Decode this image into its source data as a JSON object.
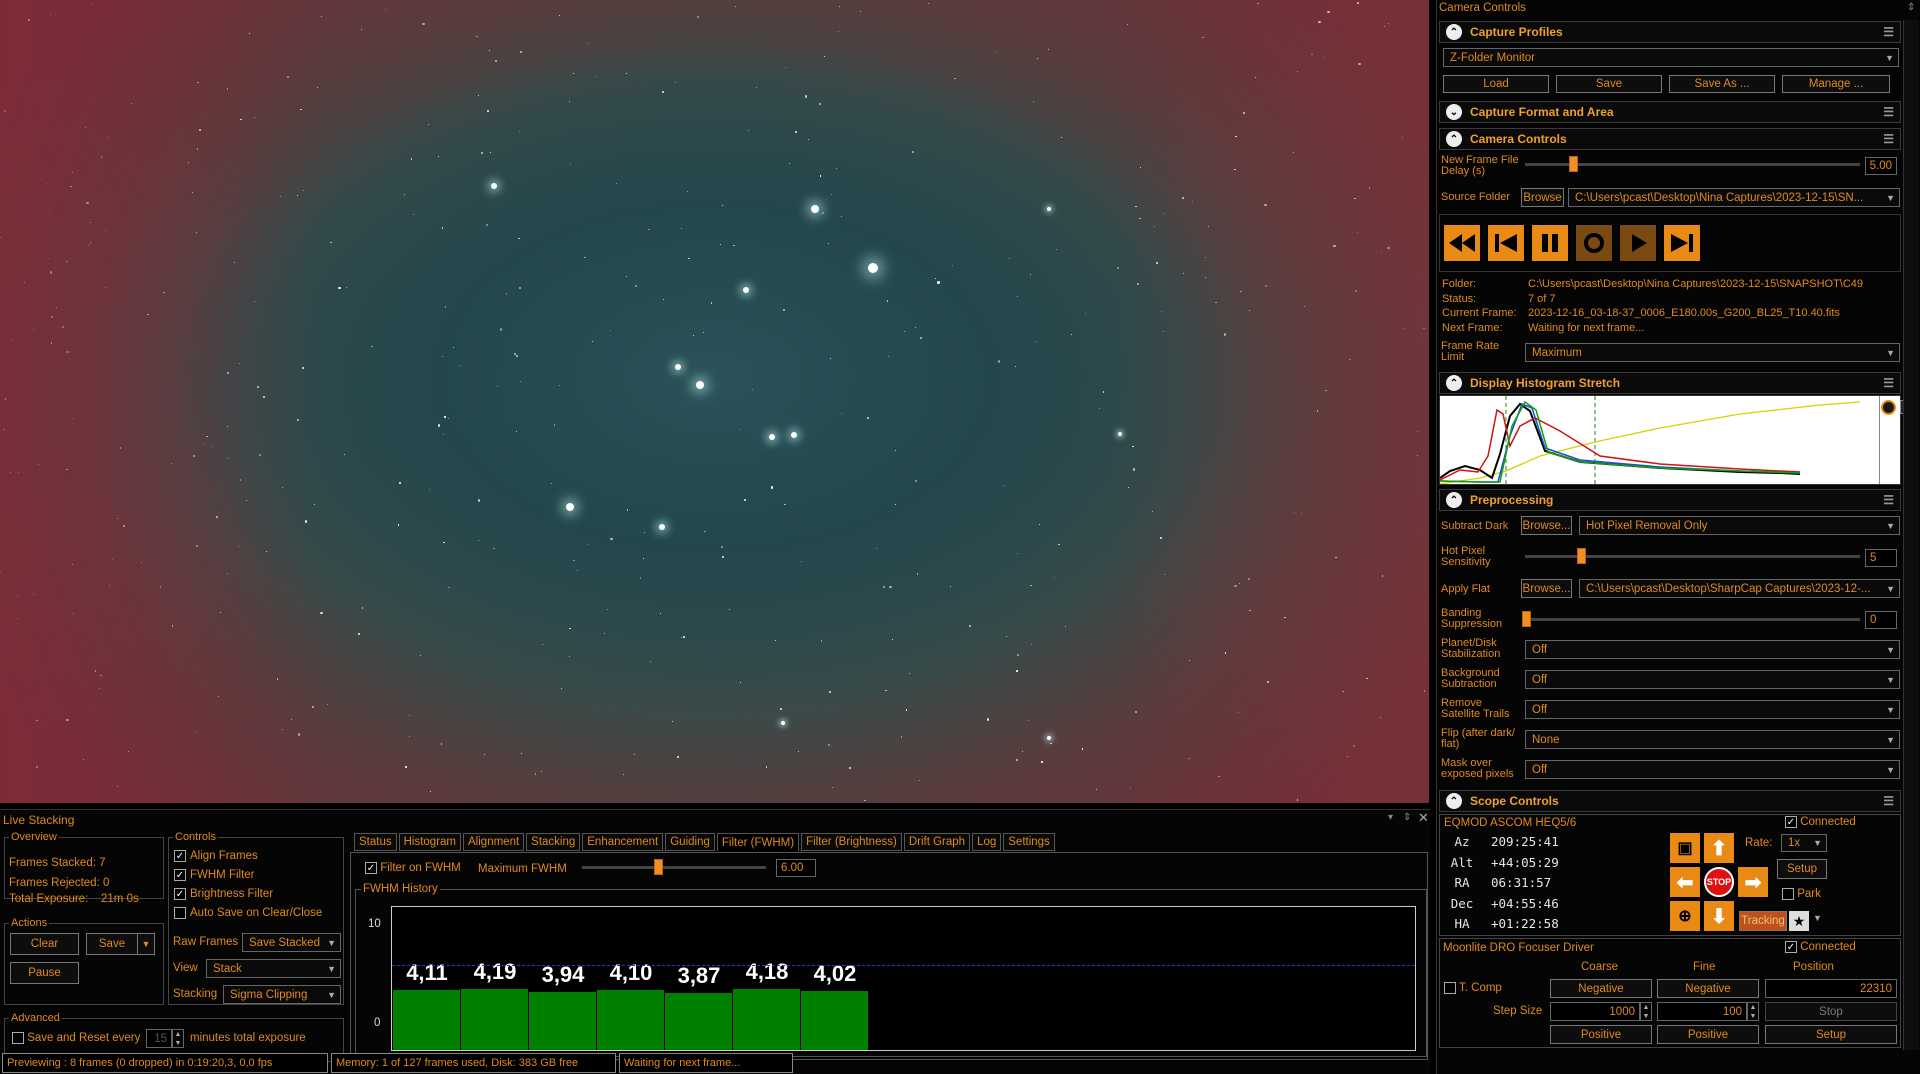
{
  "right_panel": {
    "title": "Camera Controls",
    "capture_profiles": {
      "header": "Capture Profiles",
      "profile": "Z-Folder Monitor",
      "buttons": [
        "Load",
        "Save",
        "Save As ...",
        "Manage ..."
      ]
    },
    "capture_format": {
      "header": "Capture Format and Area"
    },
    "camera_controls": {
      "header": "Camera Controls",
      "delay_label_1": "New Frame File",
      "delay_label_2": "Delay (s)",
      "delay_value": "5.00",
      "source_label": "Source Folder",
      "browse": "Browse",
      "source_path": "C:\\Users\\pcast\\Desktop\\Nina Captures\\2023-12-15\\SN...",
      "info_labels": [
        "Folder:",
        "Status:",
        "Current Frame:",
        "Next Frame:"
      ],
      "info_values": [
        "C:\\Users\\pcast\\Desktop\\Nina Captures\\2023-12-15\\SNAPSHOT\\C49",
        "7 of 7",
        "2023-12-16_03-18-37_0006_E180.00s_G200_BL25_T10.40.fits",
        "Waiting for next frame..."
      ],
      "frame_rate_label_1": "Frame Rate",
      "frame_rate_label_2": "Limit",
      "frame_rate": "Maximum"
    },
    "histogram": {
      "header": "Display Histogram Stretch"
    },
    "preprocessing": {
      "header": "Preprocessing",
      "subtract_dark_label": "Subtract Dark",
      "browse": "Browse...",
      "subtract_dark": "Hot Pixel Removal Only",
      "hot_pixel_label_1": "Hot Pixel",
      "hot_pixel_label_2": "Sensitivity",
      "hot_pixel_value": "5",
      "apply_flat_label": "Apply Flat",
      "apply_flat": "C:\\Users\\pcast\\Desktop\\SharpCap Captures\\2023-12-...",
      "banding_label_1": "Banding",
      "banding_label_2": "Suppression",
      "banding_value": "0",
      "rows": [
        {
          "l1": "Planet/Disk",
          "l2": "Stabilization",
          "value": "Off"
        },
        {
          "l1": "Background",
          "l2": "Subtraction",
          "value": "Off"
        },
        {
          "l1": "Remove",
          "l2": "Satellite Trails",
          "value": "Off"
        },
        {
          "l1": "Flip (after dark/",
          "l2": "flat)",
          "value": "None"
        },
        {
          "l1": "Mask over",
          "l2": "exposed pixels",
          "value": "Off"
        }
      ]
    },
    "scope": {
      "header": "Scope Controls",
      "driver": "EQMOD ASCOM HEQ5/6",
      "connected": "Connected",
      "coords": [
        {
          "k": "Az",
          "v": "209:25:41"
        },
        {
          "k": "Alt",
          "v": "+44:05:29"
        },
        {
          "k": "RA",
          "v": "06:31:57"
        },
        {
          "k": "Dec",
          "v": "+04:55:46"
        },
        {
          "k": "HA",
          "v": "+01:22:58"
        }
      ],
      "rate_label": "Rate:",
      "rate": "1x",
      "setup": "Setup",
      "park": "Park",
      "tracking": "Tracking",
      "stop": "STOP"
    },
    "focuser": {
      "driver": "Moonlite DRO Focuser Driver",
      "connected": "Connected",
      "col_coarse": "Coarse",
      "col_fine": "Fine",
      "col_position": "Position",
      "tcomp": "T. Comp",
      "negative": "Negative",
      "positive": "Positive",
      "position": "22310",
      "step_label": "Step Size",
      "coarse_step": "1000",
      "fine_step": "100",
      "stop": "Stop",
      "setup": "Setup"
    }
  },
  "live_stacking": {
    "title": "Live Stacking",
    "overview": {
      "label": "Overview",
      "stacked_label": "Frames Stacked:",
      "stacked": "7",
      "rejected_label": "Frames Rejected:",
      "rejected": "0",
      "exposure_label": "Total Exposure:",
      "exposure": "21m 0s"
    },
    "actions": {
      "label": "Actions",
      "clear": "Clear",
      "save": "Save",
      "pause": "Pause"
    },
    "controls": {
      "label": "Controls",
      "checks": [
        "Align Frames",
        "FWHM Filter",
        "Brightness Filter",
        "Auto Save on Clear/Close"
      ],
      "raw_label": "Raw Frames",
      "raw": "Save Stacked",
      "view_label": "View",
      "view": "Stack",
      "stacking_label": "Stacking",
      "stacking": "Sigma Clipping"
    },
    "advanced": {
      "label": "Advanced",
      "text1": "Save and Reset every",
      "minutes": "15",
      "text2": "minutes total exposure"
    },
    "tabs": [
      "Status",
      "Histogram",
      "Alignment",
      "Stacking",
      "Enhancement",
      "Guiding",
      "Filter (FWHM)",
      "Filter (Brightness)",
      "Drift Graph",
      "Log",
      "Settings"
    ],
    "active_tab": 6,
    "filter": {
      "label": "Filter on FWHM",
      "max_label": "Maximum FWHM",
      "max_value": "6.00",
      "fraction": 0.42,
      "history_label": "FWHM History"
    }
  },
  "chart_data": {
    "type": "bar",
    "title": "FWHM History",
    "values": [
      4.11,
      4.19,
      3.94,
      4.1,
      3.87,
      4.18,
      4.02
    ],
    "labels": [
      "4,11",
      "4,19",
      "3,94",
      "4,10",
      "3,87",
      "4,18",
      "4,02"
    ],
    "threshold": 6.0,
    "ylim": [
      0,
      10
    ],
    "ytick_labels": [
      "10",
      "0"
    ],
    "colors": {
      "bar": "#008000",
      "threshold": "#3030d0"
    }
  },
  "status_bar": {
    "preview": "Previewing : 8 frames (0 dropped) in 0:19:20,3, 0,0 fps",
    "memory": "Memory: 1 of 127 frames used, Disk: 383 GB free",
    "waiting": "Waiting for next frame..."
  },
  "colors": {
    "accent": "#e08a1e",
    "button": "#e88a14"
  }
}
